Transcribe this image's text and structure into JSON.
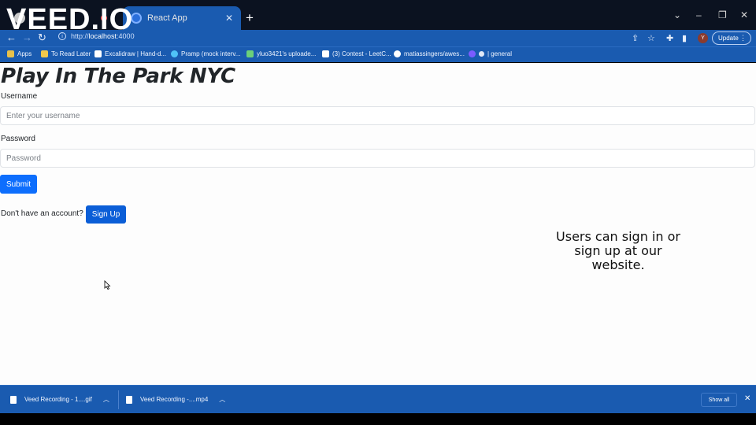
{
  "watermark": "VEED.IO",
  "browser": {
    "tabs": [
      {
        "label": ""
      },
      {
        "label": "React App"
      }
    ],
    "new_tab": "+",
    "window_controls": {
      "tab_search": "⌄",
      "minimize": "–",
      "restore": "❐",
      "close": "✕"
    },
    "url": {
      "prefix": "http://",
      "host": "localhost",
      "port": ":4000"
    },
    "update_label": "Update",
    "profile_initial": "Y",
    "bookmarks": [
      {
        "label": "Apps",
        "icon": "apps-grid-icon",
        "color": "#e8c14a"
      },
      {
        "label": "To Read Later",
        "icon": "folder-icon",
        "color": "#f2c94c"
      },
      {
        "label": "Excalidraw | Hand-d...",
        "icon": "excalidraw-icon",
        "color": "#ffffff"
      },
      {
        "label": "Pramp (mock interv...",
        "icon": "pramp-icon",
        "color": "#4fc3f7"
      },
      {
        "label": "yluo3421's uploade...",
        "icon": "upload-icon",
        "color": "#6bd07a"
      },
      {
        "label": "(3) Contest - LeetC...",
        "icon": "leetcode-icon",
        "color": "#ffffff"
      },
      {
        "label": "matiassingers/awes...",
        "icon": "github-icon",
        "color": "#ffffff"
      },
      {
        "label": "| general",
        "icon": "discord-icon",
        "color": "#7b5cff"
      }
    ]
  },
  "page": {
    "title": "Play In The Park NYC",
    "username": {
      "label": "Username",
      "placeholder": "Enter your username"
    },
    "password": {
      "label": "Password",
      "placeholder": "Password"
    },
    "submit_label": "Submit",
    "no_account_text": "Don't have an account?",
    "signup_label": "Sign Up",
    "colors": {
      "primary": "#0d6efd",
      "text": "#212529"
    }
  },
  "caption": "Users can sign in or sign up at our website.",
  "downloads": {
    "items": [
      {
        "name": "Veed Recording - 1....gif"
      },
      {
        "name": "Veed Recording -....mp4"
      }
    ],
    "show_all_label": "Show all",
    "close": "✕"
  }
}
